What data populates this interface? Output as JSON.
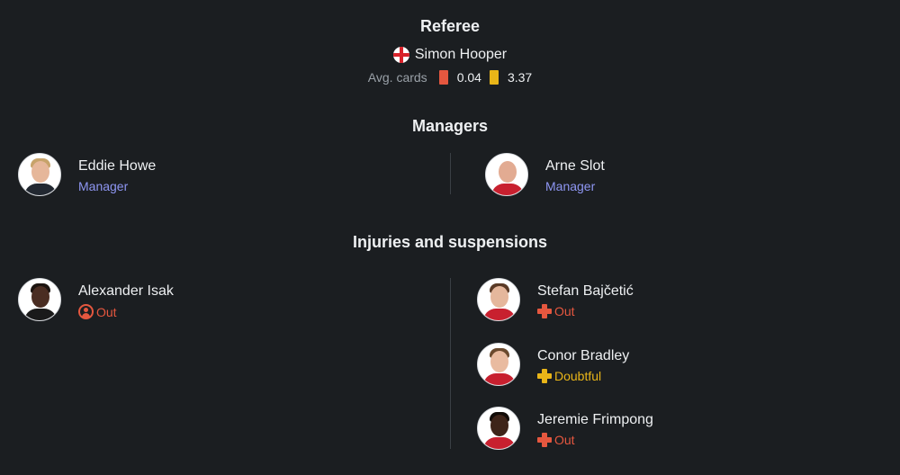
{
  "referee": {
    "title": "Referee",
    "name": "Simon Hooper",
    "flag_icon": "england-flag-icon",
    "avg_label": "Avg. cards",
    "red_avg": "0.04",
    "yellow_avg": "3.37",
    "colors": {
      "red_card": "#e5573f",
      "yellow_card": "#e9b518"
    }
  },
  "managers": {
    "title": "Managers",
    "home": {
      "name": "Eddie Howe",
      "role": "Manager"
    },
    "away": {
      "name": "Arne Slot",
      "role": "Manager"
    }
  },
  "injuries": {
    "title": "Injuries and suspensions",
    "home": [
      {
        "name": "Alexander Isak",
        "status": "Out",
        "status_icon": "suspension-icon"
      }
    ],
    "away": [
      {
        "name": "Stefan Bajčetić",
        "status": "Out",
        "status_icon": "injury-cross-icon"
      },
      {
        "name": "Conor Bradley",
        "status": "Doubtful",
        "status_icon": "injury-cross-icon"
      },
      {
        "name": "Jeremie Frimpong",
        "status": "Out",
        "status_icon": "injury-cross-icon"
      }
    ]
  },
  "colors": {
    "background": "#1b1e21",
    "manager_label": "#8e96f2",
    "out": "#e5573f",
    "doubtful": "#e9b518"
  }
}
